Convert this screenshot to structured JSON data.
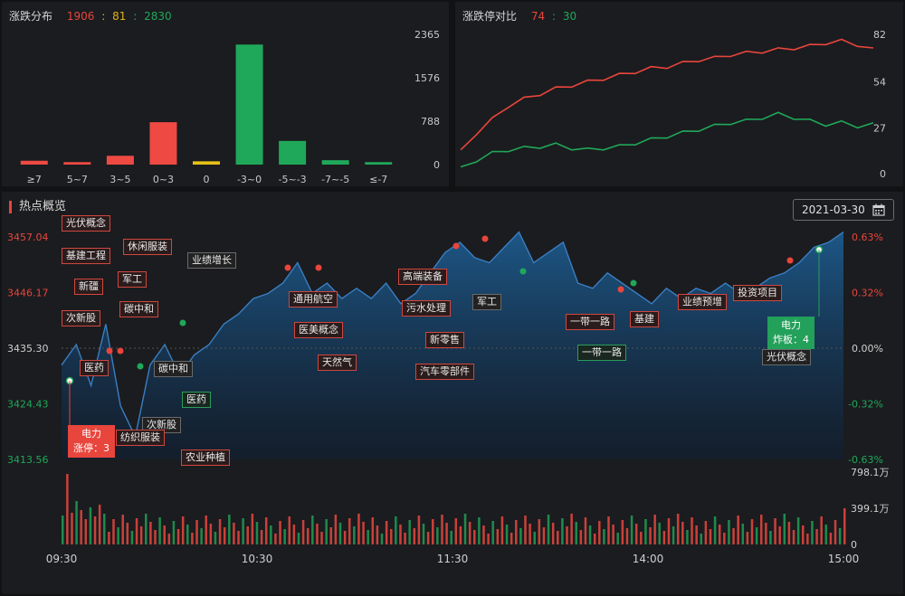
{
  "distribution": {
    "title": "涨跌分布",
    "up": "1906",
    "flat": "81",
    "down": "2830",
    "sep": ":",
    "chart_data": {
      "type": "bar",
      "categories": [
        "≥7",
        "5~7",
        "3~5",
        "0~3",
        "0",
        "-3~0",
        "-5~-3",
        "-7~-5",
        "≤-7"
      ],
      "values": [
        70,
        45,
        160,
        770,
        60,
        2180,
        430,
        80,
        45
      ],
      "ylim": [
        0,
        2365
      ],
      "yticks": [
        "2365",
        "1576",
        "788",
        "0"
      ],
      "colors": [
        "#ee4a43",
        "#ee4a43",
        "#ee4a43",
        "#ee4a43",
        "#e6c117",
        "#1fa85a",
        "#1fa85a",
        "#1fa85a",
        "#1fa85a"
      ]
    }
  },
  "limit_ratio": {
    "title": "涨跌停对比",
    "up": "74",
    "down": "30",
    "sep": ":",
    "chart_data": {
      "type": "line",
      "ylim": [
        0,
        82
      ],
      "yticks": [
        "82",
        "54",
        "27",
        "0"
      ],
      "series": [
        {
          "color": "#e8453c",
          "values": [
            14,
            24,
            32,
            40,
            44,
            47,
            50,
            52,
            54,
            56,
            58,
            60,
            62,
            63,
            65,
            67,
            68,
            70,
            71,
            72,
            73,
            74,
            75,
            77,
            78,
            76,
            74
          ]
        },
        {
          "color": "#1fa85a",
          "values": [
            4,
            8,
            12,
            14,
            15,
            16,
            17,
            15,
            14,
            15,
            16,
            18,
            20,
            22,
            24,
            26,
            28,
            30,
            31,
            33,
            35,
            33,
            31,
            29,
            30,
            28,
            30
          ]
        }
      ]
    }
  },
  "hot": {
    "title": "热点概览",
    "date": "2021-03-30",
    "y_left": [
      "3457.04",
      "3446.17",
      "3435.30",
      "3424.43",
      "3413.56"
    ],
    "y_right": [
      "0.63%",
      "0.32%",
      "0.00%",
      "-0.32%",
      "-0.63%"
    ],
    "vol_labels": [
      "798.1万",
      "399.1万",
      "0"
    ],
    "x_labels": [
      "09:30",
      "10:30",
      "11:30",
      "14:00",
      "15:00"
    ],
    "chart_data": {
      "type": "area",
      "ylim": [
        3413.56,
        3457.04
      ],
      "values": [
        3432,
        3436,
        3428,
        3440,
        3424,
        3418,
        3432,
        3436,
        3430,
        3434,
        3436,
        3440,
        3442,
        3445,
        3446,
        3448,
        3452,
        3446,
        3448,
        3445,
        3447,
        3445,
        3448,
        3444,
        3446,
        3450,
        3454,
        3456,
        3453,
        3452,
        3455,
        3458,
        3452,
        3454,
        3456,
        3448,
        3447,
        3450,
        3448,
        3446,
        3444,
        3447,
        3445,
        3447,
        3446,
        3448,
        3446,
        3447,
        3449,
        3450,
        3452,
        3455,
        3456,
        3458
      ]
    },
    "tags": {
      "t1": "光伏概念",
      "t2": "基建工程",
      "t3": "休闲服装",
      "t4": "新疆",
      "t5": "军工",
      "t6": "次新股",
      "t7": "碳中和",
      "t8": "医药",
      "t9": "碳中和",
      "t10": "医药",
      "t11": "次新股",
      "t12": "纺织服装",
      "t13": "农业种植",
      "t14": "业绩增长",
      "t15": "通用航空",
      "t16": "医美概念",
      "t17": "天然气",
      "t18": "高端装备",
      "t19": "污水处理",
      "t20": "新零售",
      "t21": "汽车零部件",
      "t22": "军工",
      "t23": "一带一路",
      "t24": "一带一路",
      "t25": "基建",
      "t26": "业绩预增",
      "t27": "投资项目",
      "t28": "光伏概念"
    },
    "callout_left": {
      "name": "电力",
      "text": "涨停：3"
    },
    "callout_right": {
      "name": "电力",
      "text": "炸板：4"
    }
  }
}
